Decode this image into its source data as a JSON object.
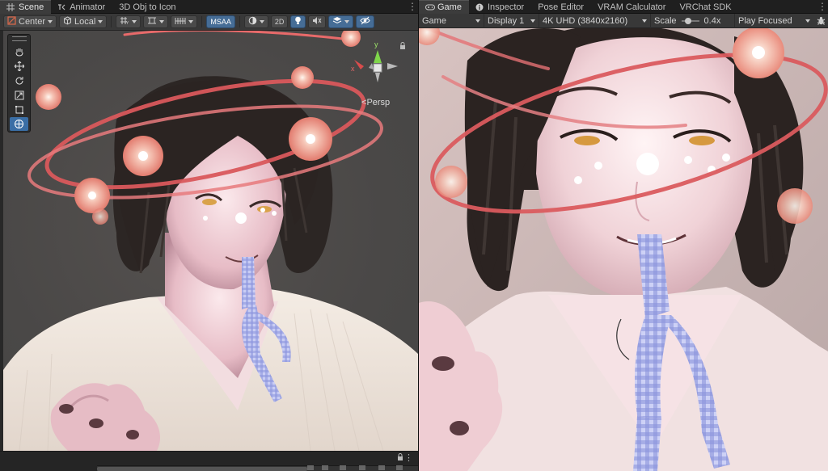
{
  "scene_tabs": [
    {
      "label": "Scene",
      "icon": "grid-icon",
      "active": true
    },
    {
      "label": "Animator",
      "icon": "animator-icon",
      "active": false
    },
    {
      "label": "3D Obj to Icon",
      "icon": "",
      "active": false
    }
  ],
  "game_tabs": [
    {
      "label": "Game",
      "icon": "gamepad-icon",
      "active": true
    },
    {
      "label": "Inspector",
      "icon": "info-icon",
      "active": false
    },
    {
      "label": "Pose Editor",
      "icon": "",
      "active": false
    },
    {
      "label": "VRAM Calculator",
      "icon": "",
      "active": false
    },
    {
      "label": "VRChat SDK",
      "icon": "",
      "active": false
    }
  ],
  "scene_toolbar": {
    "pivot_label": "Center",
    "space_label": "Local",
    "msaa_label": "MSAA",
    "twod_label": "2D"
  },
  "scene_view": {
    "camera_label": "Persp",
    "axis_y": "y",
    "axis_x": "x",
    "tools": [
      "hand-tool-icon",
      "move-tool-icon",
      "rotate-tool-icon",
      "scale-tool-icon",
      "rect-tool-icon",
      "transform-tool-icon"
    ],
    "active_tool": "transform-tool-icon"
  },
  "game_toolbar": {
    "mode_label": "Game",
    "display_label": "Display 1",
    "resolution_label": "4K UHD (3840x2160)",
    "scale_label": "Scale",
    "scale_value": "0.4x",
    "scale_fraction": 0.35,
    "play_label": "Play Focused"
  },
  "colors": {
    "accent": "#466d96",
    "ribbon": "#e2666a",
    "scene_bg": "#4a4847"
  }
}
